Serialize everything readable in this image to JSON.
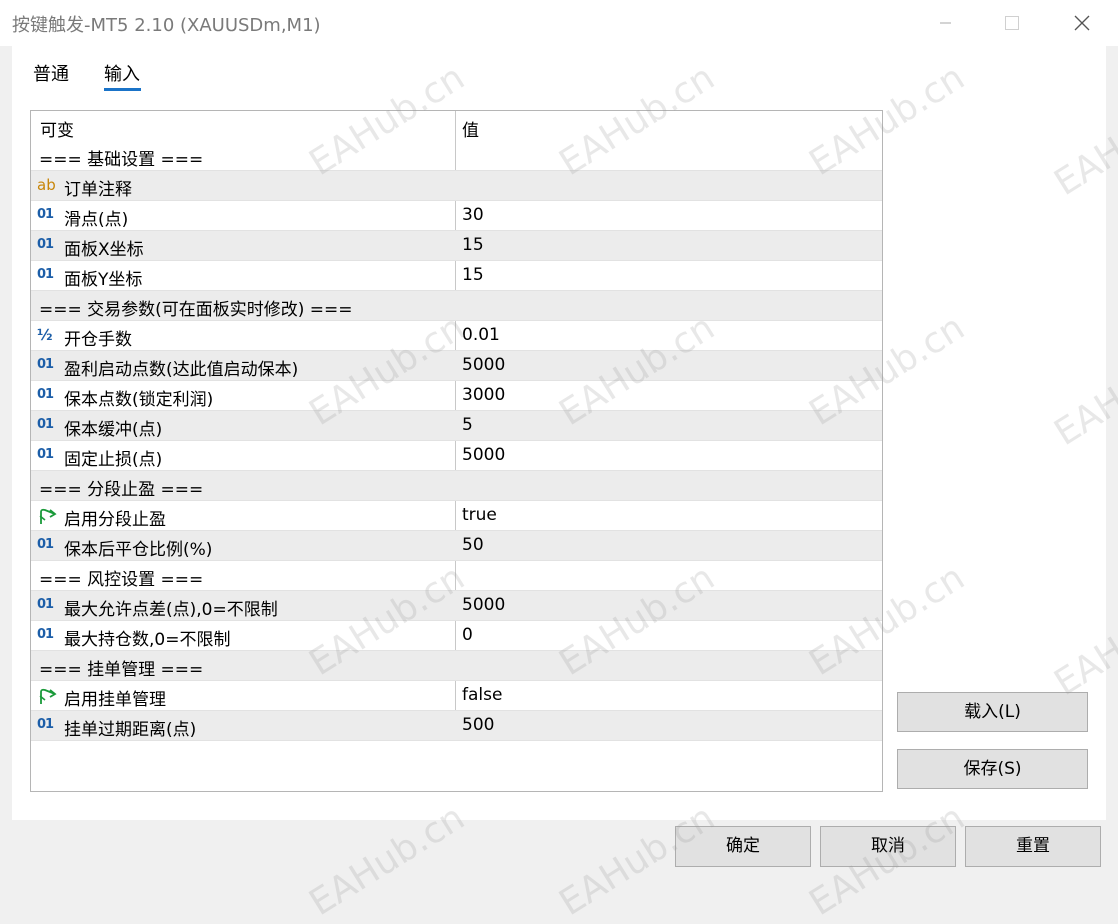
{
  "window": {
    "title": "按键触发-MT5 2.10 (XAUUSDm,M1)"
  },
  "tabs": [
    {
      "label": "普通"
    },
    {
      "label": "输入"
    }
  ],
  "grid": {
    "header": {
      "name": "可变",
      "value": "值"
    },
    "rows": [
      {
        "type": "section",
        "name": "=== 基础设置 ===",
        "value": ""
      },
      {
        "type": "string",
        "icon": "ab",
        "name": "订单注释",
        "value": ""
      },
      {
        "type": "int",
        "icon": "01",
        "name": "滑点(点)",
        "value": "30"
      },
      {
        "type": "int",
        "icon": "01",
        "name": "面板X坐标",
        "value": "15"
      },
      {
        "type": "int",
        "icon": "01",
        "name": "面板Y坐标",
        "value": "15"
      },
      {
        "type": "section",
        "name": "=== 交易参数(可在面板实时修改) ===",
        "value": ""
      },
      {
        "type": "double",
        "icon": "½",
        "name": "开仓手数",
        "value": "0.01"
      },
      {
        "type": "int",
        "icon": "01",
        "name": "盈利启动点数(达此值启动保本)",
        "value": "5000"
      },
      {
        "type": "int",
        "icon": "01",
        "name": "保本点数(锁定利润)",
        "value": "3000"
      },
      {
        "type": "int",
        "icon": "01",
        "name": "保本缓冲(点)",
        "value": "5"
      },
      {
        "type": "int",
        "icon": "01",
        "name": "固定止损(点)",
        "value": "5000"
      },
      {
        "type": "section",
        "name": "=== 分段止盈 ===",
        "value": ""
      },
      {
        "type": "bool",
        "icon": "bool",
        "name": "启用分段止盈",
        "value": "true"
      },
      {
        "type": "int",
        "icon": "01",
        "name": "保本后平仓比例(%)",
        "value": "50"
      },
      {
        "type": "section",
        "name": "=== 风控设置 ===",
        "value": ""
      },
      {
        "type": "int",
        "icon": "01",
        "name": "最大允许点差(点),0=不限制",
        "value": "5000"
      },
      {
        "type": "int",
        "icon": "01",
        "name": "最大持仓数,0=不限制",
        "value": "0"
      },
      {
        "type": "section",
        "name": "=== 挂单管理 ===",
        "value": ""
      },
      {
        "type": "bool",
        "icon": "bool",
        "name": "启用挂单管理",
        "value": "false"
      },
      {
        "type": "int",
        "icon": "01",
        "name": "挂单过期距离(点)",
        "value": "500"
      }
    ]
  },
  "buttons": {
    "load": "载入(L)",
    "save": "保存(S)",
    "ok": "确定",
    "cancel": "取消",
    "reset": "重置"
  },
  "watermark": "EAHub.cn",
  "colors": {
    "accent": "#1a73c8",
    "int_icon": "#1c5ea8",
    "string_icon": "#c8860a",
    "bool_icon": "#1a9a3a"
  }
}
